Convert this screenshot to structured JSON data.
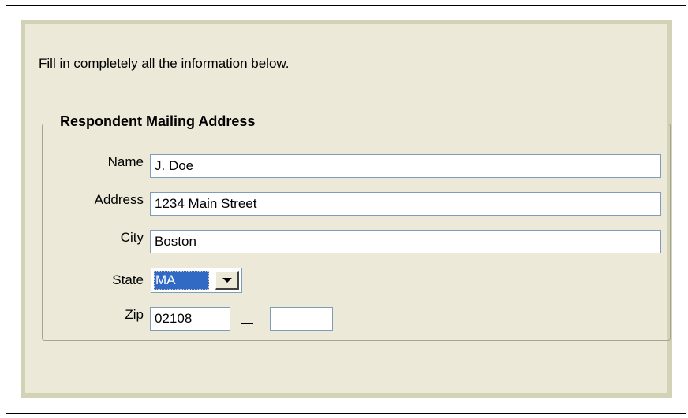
{
  "form": {
    "instructions": "Fill in completely all the information below.",
    "group_title": "Respondent Mailing Address",
    "name": {
      "label": "Name",
      "value": "J. Doe"
    },
    "address": {
      "label": "Address",
      "value": "1234 Main Street"
    },
    "city": {
      "label": "City",
      "value": "Boston"
    },
    "state": {
      "label": "State",
      "value": "MA"
    },
    "zip": {
      "label": "Zip",
      "value": "02108",
      "plus4_value": "",
      "separator": "-"
    }
  },
  "icons": {
    "state_dropdown": "chevron-down-icon"
  },
  "colors": {
    "frame_background": "#ece9d8",
    "frame_border": "#d1d2b6",
    "field_border": "#7f9db9",
    "selection": "#316ac5"
  }
}
